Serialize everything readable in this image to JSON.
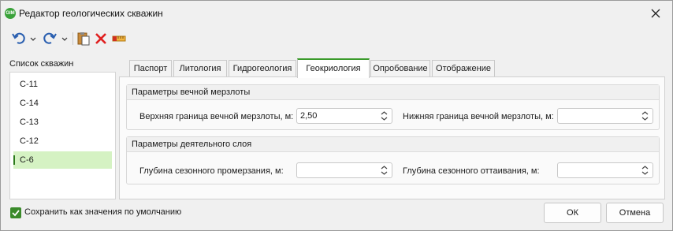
{
  "window": {
    "app_icon_text": "GIM",
    "title": "Редактор геологических скважин"
  },
  "toolbar": {
    "items": [
      "undo-icon",
      "chevron-down-icon",
      "redo-icon",
      "chevron-down-icon",
      "paste-icon",
      "delete-icon",
      "ruler-icon"
    ]
  },
  "wells": {
    "label": "Список скважин",
    "items": [
      "С-11",
      "С-14",
      "С-13",
      "С-12",
      "С-6"
    ],
    "selected": "С-6"
  },
  "tabs": [
    "Паспорт",
    "Литология",
    "Гидрогеология",
    "Геокриология",
    "Опробование",
    "Отображение"
  ],
  "active_tab": "Геокриология",
  "permafrost": {
    "title": "Параметры вечной мерзлоты",
    "upper_label": "Верхняя граница вечной мерзлоты, м:",
    "upper_value": "2,50",
    "lower_label": "Нижняя граница вечной мерзлоты, м:",
    "lower_value": ""
  },
  "active_layer": {
    "title": "Параметры деятельного слоя",
    "freeze_label": "Глубина сезонного промерзания, м:",
    "freeze_value": "",
    "thaw_label": "Глубина сезонного оттаивания, м:",
    "thaw_value": ""
  },
  "footer": {
    "save_default_label": "Сохранить как значения по умолчанию",
    "save_default_checked": true,
    "ok_label": "ОК",
    "cancel_label": "Отмена"
  },
  "colors": {
    "accent": "#3a9a2a",
    "selection": "#d5f2c3",
    "delete": "#e02020"
  }
}
